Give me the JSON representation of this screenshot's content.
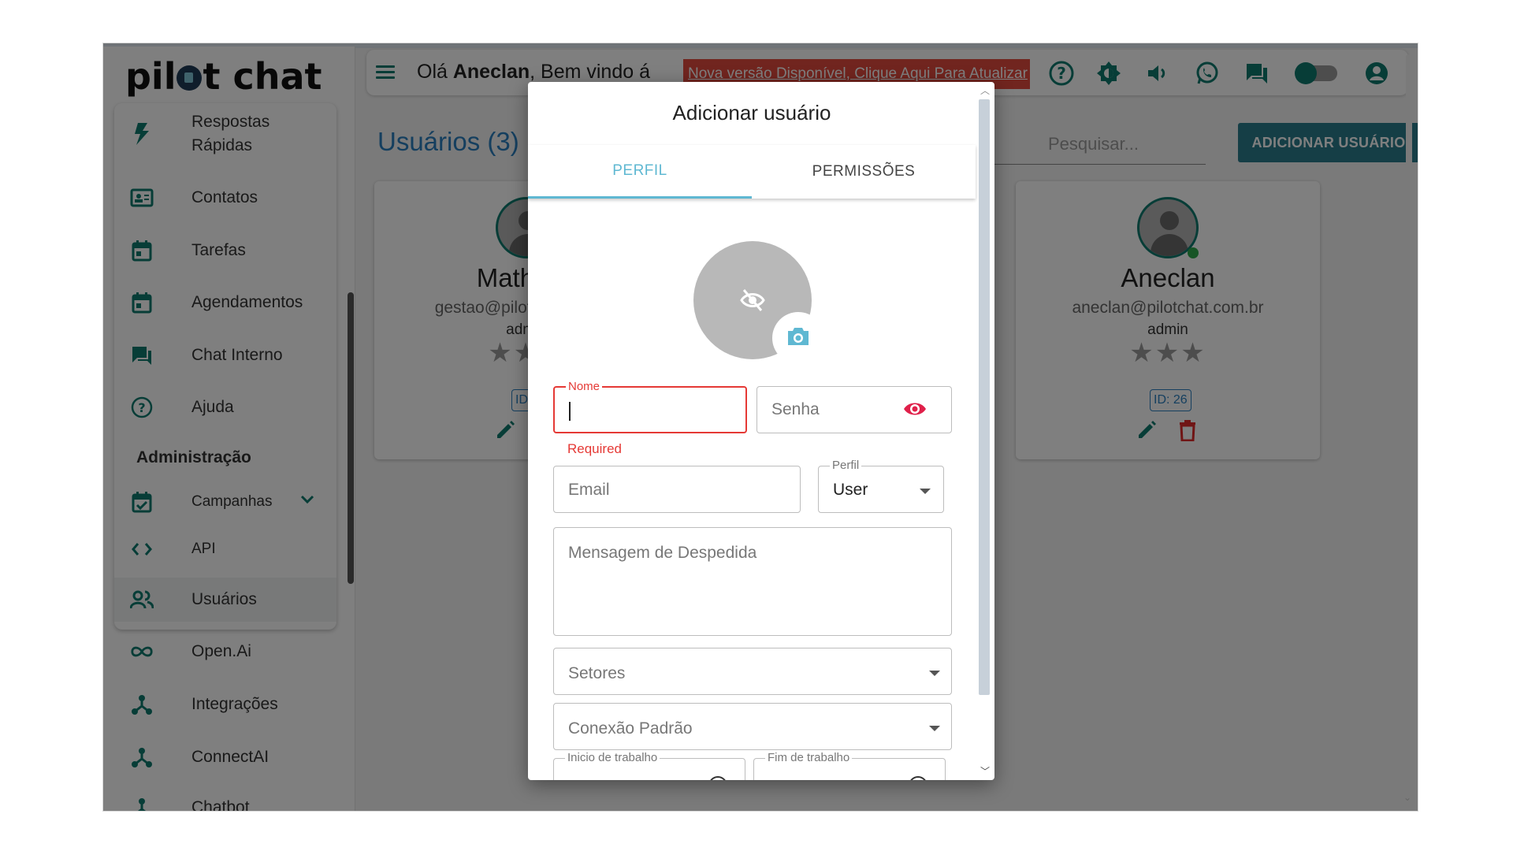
{
  "app": {
    "logo_text": "pilot chat"
  },
  "sidebar": {
    "items": [
      {
        "label": "Respostas Rápidas",
        "icon": "lightning-icon"
      },
      {
        "label": "Contatos",
        "icon": "contacts-card-icon"
      },
      {
        "label": "Tarefas",
        "icon": "calendar-icon"
      },
      {
        "label": "Agendamentos",
        "icon": "calendar-icon"
      },
      {
        "label": "Chat Interno",
        "icon": "chat-bubbles-icon"
      },
      {
        "label": "Ajuda",
        "icon": "help-circle-icon"
      }
    ],
    "section_admin": "Administração",
    "admin_items": [
      {
        "label": "Campanhas",
        "icon": "calendar-check-icon"
      },
      {
        "label": "API",
        "icon": "code-brackets-icon"
      },
      {
        "label": "Usuários",
        "icon": "users-icon"
      },
      {
        "label": "Open.Ai",
        "icon": "infinity-icon"
      },
      {
        "label": "Integrações",
        "icon": "hub-icon"
      },
      {
        "label": "ConnectAI",
        "icon": "hub-icon"
      },
      {
        "label": "Chatbot",
        "icon": "hub-icon"
      }
    ]
  },
  "topbar": {
    "greeting_prefix": "Olá ",
    "greeting_name": "Aneclan",
    "greeting_suffix": ", Bem vindo á",
    "update_banner": "Nova versão Disponível, Clique Aqui Para Atualizar"
  },
  "main": {
    "title": "Usuários (3)",
    "search_placeholder": "Pesquisar...",
    "add_button": "ADICIONAR USUÁRIO",
    "cards": [
      {
        "name": "Matheus",
        "email": "gestao@pilotchat.com.br",
        "role": "admin",
        "id": "ID:"
      },
      {
        "name": "Aneclan",
        "email": "aneclan@pilotchat.com.br",
        "role": "admin",
        "id": "ID: 26"
      }
    ],
    "stars": "★★★"
  },
  "modal": {
    "title": "Adicionar usuário",
    "tabs": [
      "PERFIL",
      "PERMISSÕES"
    ],
    "active_tab": "PERFIL",
    "fields": {
      "nome_label": "Nome",
      "nome_value": "",
      "nome_error": "Required",
      "senha_placeholder": "Senha",
      "email_placeholder": "Email",
      "perfil_label": "Perfil",
      "perfil_value": "User",
      "mensagem_placeholder": "Mensagem de Despedida",
      "setores_placeholder": "Setores",
      "conexao_placeholder": "Conexão Padrão",
      "inicio_label": "Inicio de trabalho",
      "fim_label": "Fim de trabalho"
    }
  },
  "colors": {
    "accent": "#0f7a6f",
    "tab_active": "#5fb8d2",
    "error": "#e53935",
    "update_banner": "#e24b3f",
    "add_button": "#2b7c8c"
  }
}
